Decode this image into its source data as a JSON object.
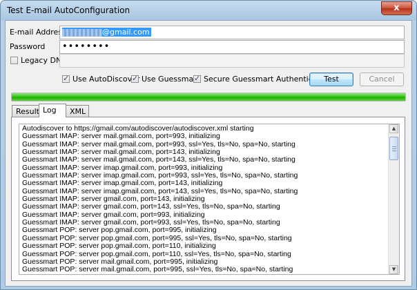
{
  "window": {
    "title": "Test E-mail AutoConfiguration",
    "close_glyph": "x"
  },
  "form": {
    "email_label": "E-mail Address",
    "email_value": "@gmail.com",
    "password_label": "Password",
    "password_value": "••••••••",
    "legacy_dn_label": "Legacy DN",
    "legacy_dn_checked": false
  },
  "options": {
    "use_autodiscover": {
      "label": "Use AutoDiscover",
      "checked": true
    },
    "use_guessmart": {
      "label": "Use Guessmart",
      "checked": true
    },
    "secure_guessmart": {
      "label": "Secure Guessmart Authentication",
      "checked": true
    }
  },
  "buttons": {
    "test": "Test",
    "cancel": "Cancel"
  },
  "progress": {
    "fraction": 1.0,
    "color": "#20b000"
  },
  "tabs": [
    {
      "label": "Results",
      "active": false
    },
    {
      "label": "Log",
      "active": true
    },
    {
      "label": "XML",
      "active": false
    }
  ],
  "log_lines": [
    "Autodiscover to https://gmail.com/autodiscover/autodiscover.xml starting",
    "Guessmart IMAP: server mail.gmail.com, port=993, initializing",
    "Guessmart IMAP: server mail.gmail.com, port=993, ssl=Yes, tls=No, spa=No, starting",
    "Guessmart IMAP: server mail.gmail.com, port=143, initializing",
    "Guessmart IMAP: server mail.gmail.com, port=143, ssl=Yes, tls=No, spa=No, starting",
    "Guessmart IMAP: server imap.gmail.com, port=993, initializing",
    "Guessmart IMAP: server imap.gmail.com, port=993, ssl=Yes, tls=No, spa=No, starting",
    "Guessmart IMAP: server imap.gmail.com, port=143, initializing",
    "Guessmart IMAP: server imap.gmail.com, port=143, ssl=Yes, tls=No, spa=No, starting",
    "Guessmart IMAP: server gmail.com, port=143, initializing",
    "Guessmart IMAP: server gmail.com, port=143, ssl=Yes, tls=No, spa=No, starting",
    "Guessmart IMAP: server gmail.com, port=993, initializing",
    "Guessmart IMAP: server gmail.com, port=993, ssl=Yes, tls=No, spa=No, starting",
    "Guessmart POP: server pop.gmail.com, port=995, initializing",
    "Guessmart POP: server pop.gmail.com, port=995, ssl=Yes, tls=No, spa=No, starting",
    "Guessmart POP: server pop.gmail.com, port=110, initializing",
    "Guessmart POP: server pop.gmail.com, port=110, ssl=Yes, tls=No, spa=No, starting",
    "Guessmart POP: server mail.gmail.com, port=995, initializing",
    "Guessmart POP: server mail.gmail.com, port=995, ssl=Yes, tls=No, spa=No, starting"
  ],
  "icons": {
    "scroll_up": "scroll-up-arrow-icon",
    "scroll_down": "scroll-down-arrow-icon",
    "close": "close-icon",
    "check": "checkmark-icon"
  }
}
